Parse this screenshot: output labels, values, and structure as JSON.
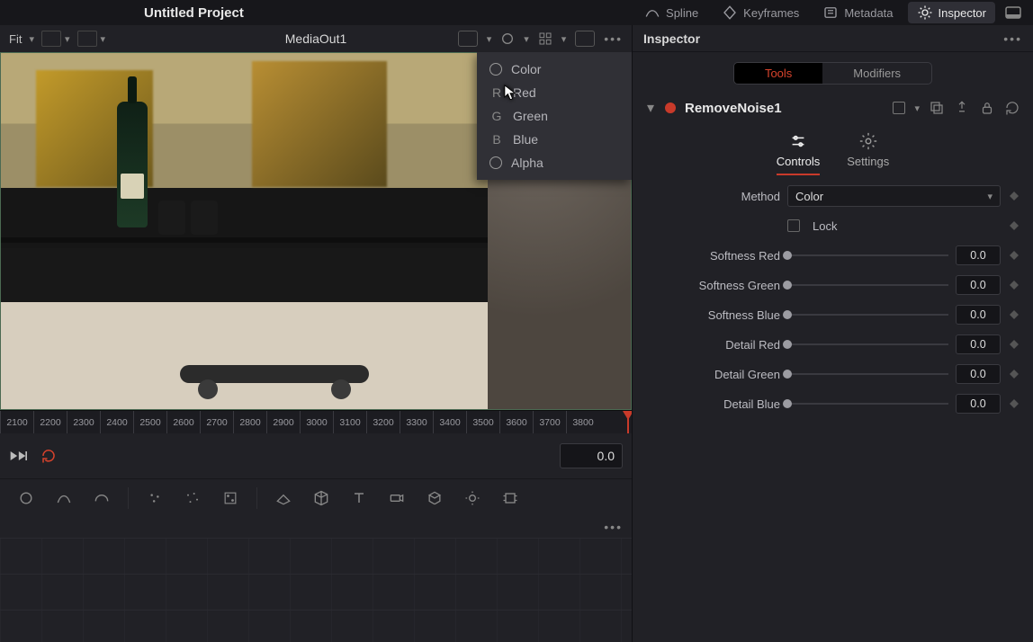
{
  "project_title": "Untitled Project",
  "top_nav": {
    "spline": "Spline",
    "keyframes": "Keyframes",
    "metadata": "Metadata",
    "inspector": "Inspector"
  },
  "viewer": {
    "fit_label": "Fit",
    "node_title": "MediaOut1",
    "channel_menu": {
      "color": "Color",
      "red_key": "R",
      "red": "Red",
      "green_key": "G",
      "green": "Green",
      "blue_key": "B",
      "blue": "Blue",
      "alpha": "Alpha"
    }
  },
  "ruler_ticks": [
    "2100",
    "2200",
    "2300",
    "2400",
    "2500",
    "2600",
    "2700",
    "2800",
    "2900",
    "3000",
    "3100",
    "3200",
    "3300",
    "3400",
    "3500",
    "3600",
    "3700",
    "3800"
  ],
  "transport": {
    "time_display": "0.0"
  },
  "inspector": {
    "panel_title": "Inspector",
    "tabs": {
      "tools": "Tools",
      "modifiers": "Modifiers"
    },
    "node_name": "RemoveNoise1",
    "ctrl_tabs": {
      "controls": "Controls",
      "settings": "Settings"
    },
    "method": {
      "label": "Method",
      "value": "Color"
    },
    "lock_label": "Lock",
    "sliders": [
      {
        "label": "Softness Red",
        "value": "0.0"
      },
      {
        "label": "Softness Green",
        "value": "0.0"
      },
      {
        "label": "Softness Blue",
        "value": "0.0"
      },
      {
        "label": "Detail Red",
        "value": "0.0"
      },
      {
        "label": "Detail Green",
        "value": "0.0"
      },
      {
        "label": "Detail Blue",
        "value": "0.0"
      }
    ]
  }
}
